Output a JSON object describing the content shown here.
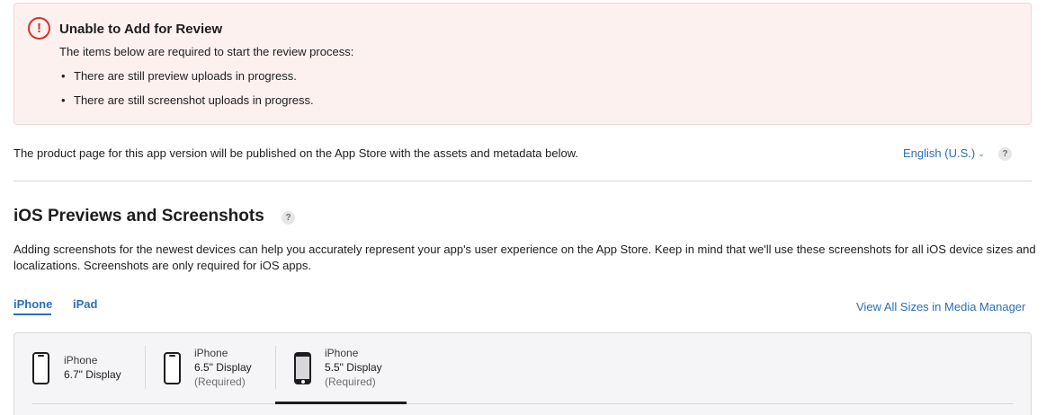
{
  "alert": {
    "icon": "exclamation-circle-icon",
    "icon_glyph": "!",
    "title": "Unable to Add for Review",
    "description": "The items below are required to start the review process:",
    "items": [
      "There are still preview uploads in progress.",
      "There are still screenshot uploads in progress."
    ],
    "colors": {
      "accent": "#d1342f",
      "background": "#fdf1f0"
    }
  },
  "intro": {
    "text": "The product page for this app version will be published on the App Store with the assets and metadata below.",
    "language": "English (U.S.)",
    "language_chevron": "⌄",
    "help_glyph": "?"
  },
  "section": {
    "title": "iOS Previews and Screenshots",
    "help_glyph": "?",
    "description": "Adding screenshots for the newest devices can help you accurately represent your app's user experience on the App Store. Keep in mind that we'll use these screenshots for all iOS device sizes and localizations. Screenshots are only required for iOS apps."
  },
  "tabs": [
    {
      "label": "iPhone",
      "selected": true
    },
    {
      "label": "iPad",
      "selected": false
    }
  ],
  "view_all_link": "View All Sizes in Media Manager",
  "devices": [
    {
      "name": "iPhone",
      "size": "6.7\" Display",
      "required": "",
      "icon": "iphone-notch-icon",
      "selected": false
    },
    {
      "name": "iPhone",
      "size": "6.5\" Display",
      "required": "(Required)",
      "icon": "iphone-notch-icon",
      "selected": false
    },
    {
      "name": "iPhone",
      "size": "5.5\" Display",
      "required": "(Required)",
      "icon": "iphone-home-button-icon",
      "selected": true
    }
  ],
  "colors": {
    "link": "#2a6fba",
    "text": "#1d1d1f"
  }
}
